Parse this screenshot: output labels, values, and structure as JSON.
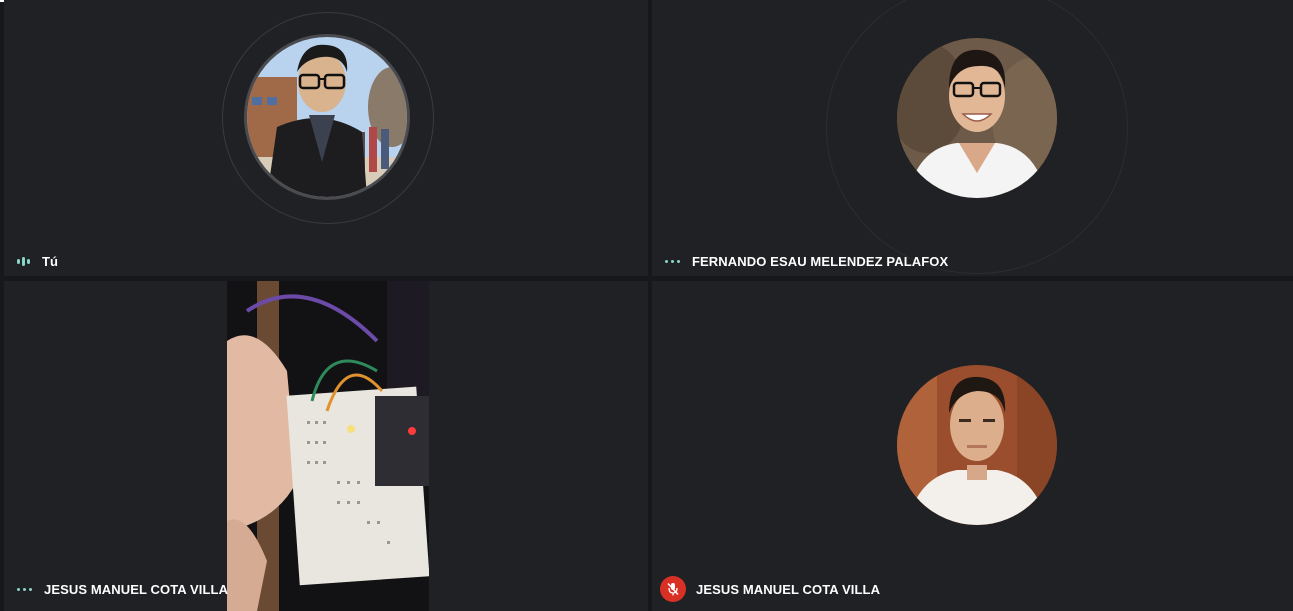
{
  "participants": [
    {
      "name": "Tú",
      "indicator": "speaking",
      "avatar": "photo-man-glasses-suit",
      "self": true
    },
    {
      "name": "FERNANDO ESAU MELENDEZ PALAFOX",
      "indicator": "idle-dots",
      "avatar": "photo-man-glasses-smiling"
    },
    {
      "name": "JESUS MANUEL COTA VILLA",
      "indicator": "idle-dots",
      "video": "camera-feed-breadboard-circuit"
    },
    {
      "name": "JESUS MANUEL COTA VILLA",
      "indicator": "muted",
      "avatar": "photo-man-white-shirt"
    }
  ],
  "colors": {
    "background": "#202124",
    "indicator": "#8ad3c7",
    "muted": "#d93025",
    "text": "#ffffff"
  }
}
